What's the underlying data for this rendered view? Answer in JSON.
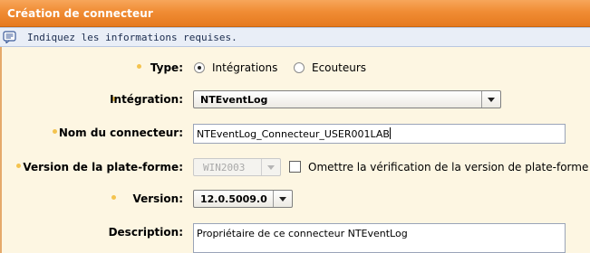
{
  "window": {
    "title": "Création de connecteur"
  },
  "info": {
    "icon": "message-icon",
    "text": "Indiquez les informations requises."
  },
  "form": {
    "type": {
      "label": "Type:",
      "options": [
        "Intégrations",
        "Ecouteurs"
      ],
      "selected": "Intégrations"
    },
    "integration": {
      "label": "Intégration:",
      "value": "NTEventLog"
    },
    "connector_name": {
      "label": "Nom du connecteur:",
      "value": "NTEventLog_Connecteur_USER001LAB"
    },
    "platform_version": {
      "label": "Version de la plate-forme:",
      "value": "WIN2003",
      "checkbox_label": "Omettre la vérification de la version de plate-forme",
      "checkbox_checked": false
    },
    "version": {
      "label": "Version:",
      "value": "12.0.5009.0"
    },
    "description": {
      "label": "Description:",
      "value": "Propriétaire de ce connecteur NTEventLog"
    }
  },
  "colors": {
    "title_bar": "#f08c34",
    "info_bar": "#e9eef7",
    "background": "#fdf6e2",
    "required_bullet": "#f4c34e"
  }
}
